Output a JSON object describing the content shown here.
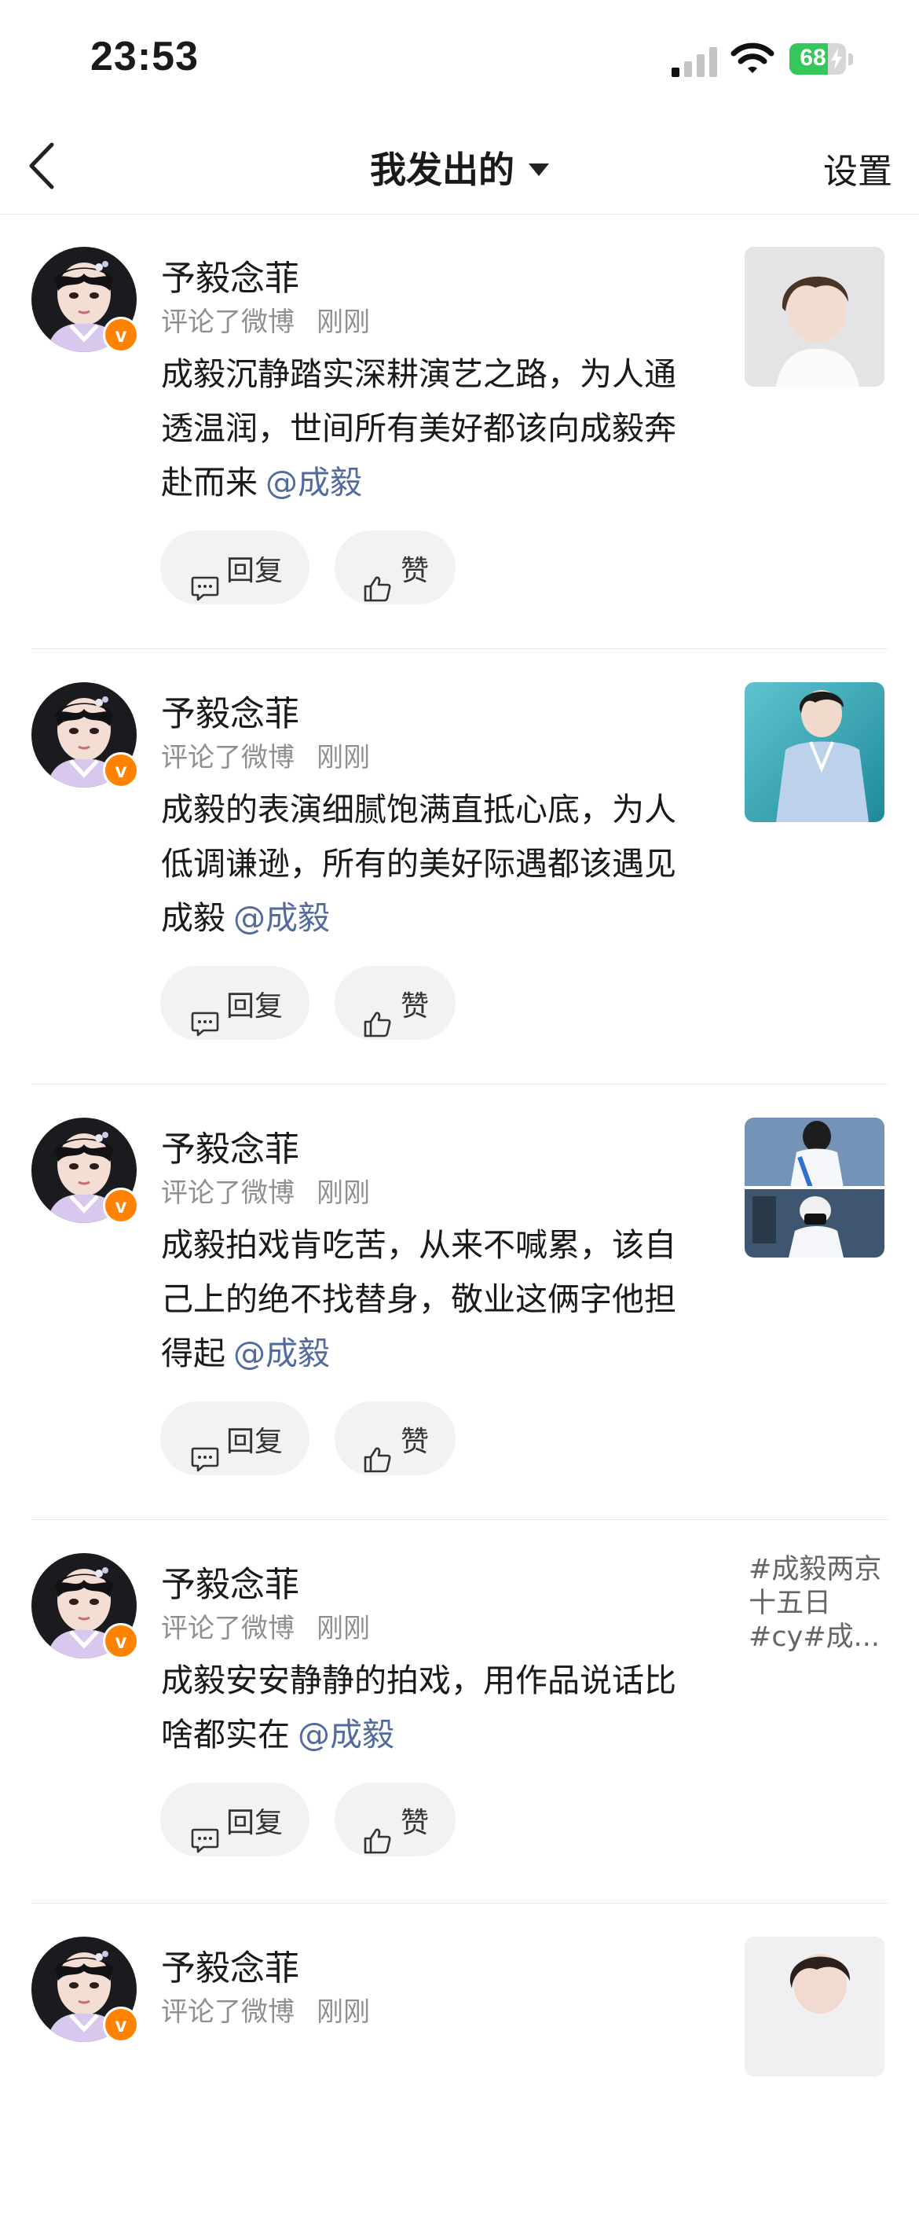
{
  "status_bar": {
    "time": "23:53",
    "battery_percent": "68",
    "battery_level": 0.68
  },
  "nav": {
    "title": "我发出的",
    "settings_label": "设置"
  },
  "actions": {
    "reply_label": "回复",
    "like_label": "赞"
  },
  "comments": [
    {
      "user": "予毅念菲",
      "action": "评论了微博",
      "time": "刚刚",
      "text": "成毅沉静踏实深耕演艺之路，为人通透温润，世间所有美好都该向成毅奔赴而来",
      "mention": "@成毅",
      "thumbnail": {
        "type": "image",
        "description": "portrait-white-background"
      }
    },
    {
      "user": "予毅念菲",
      "action": "评论了微博",
      "time": "刚刚",
      "text": "成毅的表演细腻饱满直抵心底，为人低调谦逊，所有的美好际遇都该遇见成毅",
      "mention": "@成毅",
      "thumbnail": {
        "type": "image",
        "description": "photo-blue-shirt"
      }
    },
    {
      "user": "予毅念菲",
      "action": "评论了微博",
      "time": "刚刚",
      "text": "成毅拍戏肯吃苦，从来不喊累，该自己上的绝不找替身，敬业这俩字他担得起",
      "mention": "@成毅",
      "thumbnail": {
        "type": "image",
        "description": "airport-photos-collage"
      }
    },
    {
      "user": "予毅念菲",
      "action": "评论了微博",
      "time": "刚刚",
      "text": "成毅安安静静的拍戏，用作品说话比啥都实在",
      "mention": "@成毅",
      "thumbnail": {
        "type": "text",
        "text": "#成毅两京十五日#cy#成..."
      }
    },
    {
      "user": "予毅念菲",
      "action": "评论了微博",
      "time": "刚刚",
      "text": "",
      "mention": "",
      "thumbnail": {
        "type": "image",
        "description": "portrait-partial"
      }
    }
  ]
}
